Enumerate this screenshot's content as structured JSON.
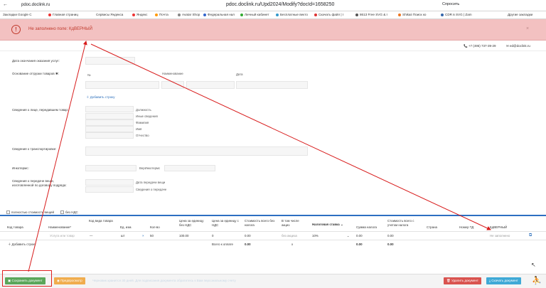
{
  "browser": {
    "domain": "pdoc.doclink.ru",
    "title": "pdoc.doclink.ru/Upd2024/Modify?docId=1658250",
    "ask": "Спросить",
    "bookmarks": [
      "Закладки Google C",
      "Главная страниц",
      "Сервисы Яндекса",
      "Яндекс",
      "Почта",
      "Avatar Shop",
      "Федеральная нал",
      "Личный кабинет",
      "Бесплатные векто",
      "Скачать файл | I",
      "8613 Free SVG & I",
      "Shikaii Поиск ко",
      "CDR в SVG | Zam",
      "Другие закладки"
    ]
  },
  "alert": {
    "message": "Не заполнено поле: КдВЕРНЫЙ",
    "close": "×"
  },
  "contacts": {
    "phone": "+7 (495) 737-39-29",
    "email": "ed@doclink.ru"
  },
  "form": {
    "end_date_label": "Дата окончания оказания услуг:",
    "basis_label": "Основание отгрузки товаров ✱:",
    "col_number": "№",
    "col_name": "Наименование",
    "col_date": "Дата",
    "add_row": "Добавить строку",
    "person_label": "Сведения о лице, передавшем товар:",
    "person_fields": [
      "Должность",
      "Иные сведения",
      "Фамилия",
      "Имя",
      "Отчество"
    ],
    "transport_label": "Сведения о транспортировке:",
    "incoterms_label": "Инкотермс:",
    "incoterms_version": "ВерИнкотермс",
    "handover_label": "Сведения о передаче вещи, изготовленной по договору подряда:",
    "handover_date": "Дата передачи вещи",
    "handover_info": "Сведения о передаче"
  },
  "checkboxes": {
    "rent": "полностью стоимость вещей",
    "no_vat": "без НДС"
  },
  "table": {
    "headers": [
      "Код товара",
      "Наименование*",
      "Код вида товара",
      "Ед. изм.",
      "Кол-во",
      "Цена за единицу без НДС",
      "Цена за единицу с НДС",
      "Стоимость всего без налога",
      "В том числе акциз",
      "Налоговая ставка",
      "Сумма налога",
      "Стоимость всего с учетом налога",
      "Страна",
      "Номер ТД",
      "КдВЕРНЫЙ"
    ],
    "row": {
      "name_placeholder": "Услуга или товар",
      "kind": "—",
      "unit": "шт",
      "unit_clear": "×",
      "qty": "50",
      "price": "100.00",
      "price_vat": "0",
      "total": "0.00",
      "excise": "без акциза",
      "rate": "10%",
      "tax": "0.00",
      "total_vat": "0.00",
      "kdverny": "Не заполнено"
    },
    "add_row": "Добавить строку",
    "totals": {
      "label": "Всего к оплате",
      "total": "0.00",
      "excise": "х",
      "tax": "0.00",
      "total_vat": "0.00"
    }
  },
  "footer": {
    "save": "Сохранить документ",
    "preview": "Предпросмотр",
    "notice": "Черновик хранится 30 дней. Для подписания документа обратитесь к Вам персональному счету",
    "delete": "Удалить документ",
    "download": "Скачать документ"
  }
}
